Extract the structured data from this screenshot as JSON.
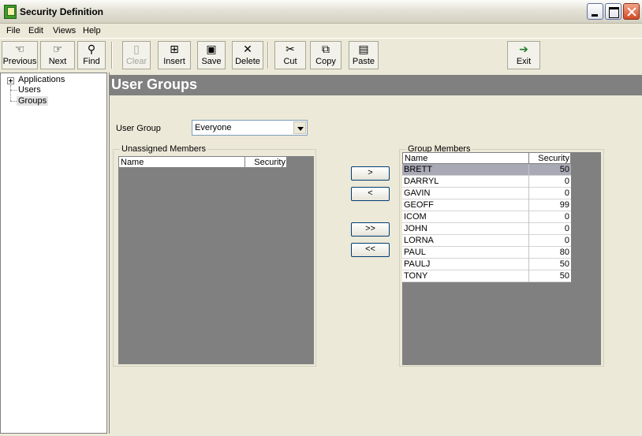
{
  "window": {
    "title": "Security Definition"
  },
  "menu": [
    "File",
    "Edit",
    "Views",
    "Help"
  ],
  "toolbar": {
    "previous": "Previous",
    "next": "Next",
    "find": "Find",
    "clear": "Clear",
    "insert": "Insert",
    "save": "Save",
    "delete": "Delete",
    "cut": "Cut",
    "copy": "Copy",
    "paste": "Paste",
    "exit": "Exit"
  },
  "tree": {
    "applications": "Applications",
    "users": "Users",
    "groups": "Groups"
  },
  "main": {
    "title": "User Groups",
    "user_group_label": "User Group",
    "user_group_value": "Everyone",
    "unassigned_title": "Unassigned Members",
    "group_members_title": "Group Members",
    "col_name": "Name",
    "col_security": "Security"
  },
  "transfer": {
    "add_one": ">",
    "remove_one": "<",
    "add_all": ">>",
    "remove_all": "<<"
  },
  "members": [
    {
      "name": "BRETT",
      "security": "50"
    },
    {
      "name": "DARRYL",
      "security": "0"
    },
    {
      "name": "GAVIN",
      "security": "0"
    },
    {
      "name": "GEOFF",
      "security": "99"
    },
    {
      "name": "ICOM",
      "security": "0"
    },
    {
      "name": "JOHN",
      "security": "0"
    },
    {
      "name": "LORNA",
      "security": "0"
    },
    {
      "name": "PAUL",
      "security": "80"
    },
    {
      "name": "PAULJ",
      "security": "50"
    },
    {
      "name": "TONY",
      "security": "50"
    }
  ]
}
